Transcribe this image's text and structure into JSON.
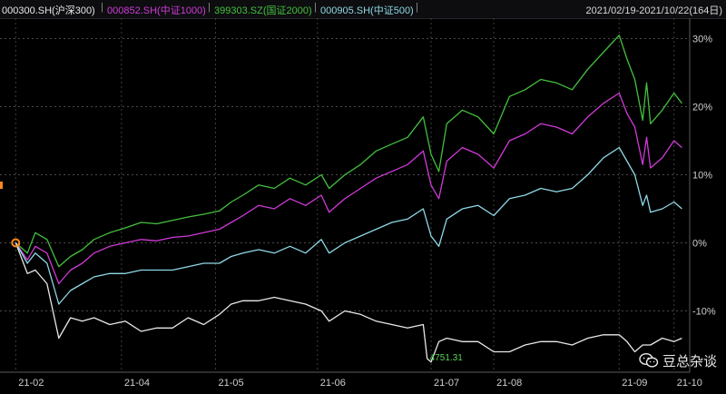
{
  "legend": {
    "items": [
      {
        "label": "000300.SH(沪深300)",
        "color": "#e8e8e8"
      },
      {
        "label": "000852.SH(中证1000)",
        "color": "#d03ad8"
      },
      {
        "label": "399303.SZ(国证2000)",
        "color": "#44c03e"
      },
      {
        "label": "000905.SH(中证500)",
        "color": "#8fd8e6"
      }
    ],
    "separator": "|",
    "range": "2021/02/19-2021/10/22(164日)"
  },
  "watermark": {
    "text": "豆总杂谈",
    "icon": "wechat-icon"
  },
  "chart_data": {
    "type": "line",
    "x_ticks": [
      "21-02",
      "21-04",
      "21-05",
      "21-06",
      "21-07",
      "21-08",
      "21-09",
      "21-10"
    ],
    "x_tick_days": [
      0,
      27,
      51,
      77,
      106,
      122,
      154,
      168
    ],
    "x_range_days": [
      -4,
      172
    ],
    "y_ticks": [
      "30%",
      "20%",
      "10%",
      "0%",
      "-10%"
    ],
    "y_tick_values": [
      30,
      20,
      10,
      0,
      -10
    ],
    "ylim": [
      -19,
      33
    ],
    "grid": true,
    "annotations": [
      {
        "series": "000300.SH(沪深300)",
        "x": 105,
        "text": "4751.31"
      }
    ],
    "series": [
      {
        "name": "399303.SZ(国证2000)",
        "color": "#44c03e",
        "x": [
          0,
          3,
          5,
          8,
          11,
          14,
          17,
          20,
          24,
          28,
          32,
          36,
          40,
          44,
          48,
          52,
          55,
          58,
          62,
          66,
          70,
          74,
          78,
          80,
          84,
          88,
          92,
          96,
          100,
          104,
          106,
          108,
          110,
          114,
          118,
          122,
          126,
          130,
          134,
          138,
          142,
          146,
          150,
          154,
          156,
          158,
          160,
          161,
          162,
          165,
          168,
          170
        ],
        "y": [
          0,
          -1.5,
          1.5,
          0.5,
          -3.5,
          -2,
          -1,
          0.5,
          1.5,
          2.2,
          3,
          2.8,
          3.3,
          3.8,
          4.2,
          4.7,
          6,
          7,
          8.5,
          8,
          9.5,
          8.5,
          10,
          8,
          10,
          11.5,
          13.5,
          14.5,
          15.5,
          18.5,
          13,
          10.5,
          17.5,
          19.5,
          18.5,
          16,
          21.5,
          22.5,
          24,
          23.5,
          22.5,
          25.5,
          28,
          30.5,
          27,
          24,
          18,
          23.5,
          17.5,
          19.5,
          22,
          20.5
        ]
      },
      {
        "name": "000852.SH(中证1000)",
        "color": "#d03ad8",
        "x": [
          0,
          3,
          5,
          8,
          11,
          14,
          17,
          20,
          24,
          28,
          32,
          36,
          40,
          44,
          48,
          52,
          55,
          58,
          62,
          66,
          70,
          74,
          78,
          80,
          84,
          88,
          92,
          96,
          100,
          104,
          106,
          108,
          110,
          114,
          118,
          122,
          126,
          130,
          134,
          138,
          142,
          146,
          150,
          154,
          156,
          158,
          160,
          161,
          162,
          165,
          168,
          170
        ],
        "y": [
          0,
          -2.5,
          -0.5,
          -1.5,
          -6,
          -4,
          -3,
          -1.5,
          -0.5,
          0,
          0.5,
          0.3,
          0.8,
          1,
          1.5,
          2,
          3,
          4,
          5.5,
          5,
          6.5,
          5.5,
          7,
          4.5,
          6.5,
          8,
          9.5,
          10.5,
          11.5,
          13.5,
          8.5,
          6.5,
          12,
          14,
          13,
          11,
          15,
          16,
          17.5,
          17,
          16,
          18.5,
          20.5,
          22,
          19,
          17,
          11.5,
          15.5,
          11,
          12.5,
          15,
          14
        ]
      },
      {
        "name": "000905.SH(中证500)",
        "color": "#8fd8e6",
        "x": [
          0,
          3,
          5,
          8,
          11,
          14,
          17,
          20,
          24,
          28,
          32,
          36,
          40,
          44,
          48,
          52,
          55,
          58,
          62,
          66,
          70,
          74,
          78,
          80,
          84,
          88,
          92,
          96,
          100,
          104,
          106,
          108,
          110,
          114,
          118,
          122,
          126,
          130,
          134,
          138,
          142,
          146,
          150,
          154,
          156,
          158,
          160,
          161,
          162,
          165,
          168,
          170
        ],
        "y": [
          0,
          -3,
          -1.5,
          -3,
          -9,
          -7,
          -6,
          -5,
          -4.5,
          -4.5,
          -4,
          -4,
          -4,
          -3.5,
          -3,
          -3,
          -2,
          -1.5,
          -1,
          -1.5,
          -0.5,
          -1.5,
          0.5,
          -1.5,
          0,
          1,
          2,
          3,
          3.5,
          5,
          1,
          -0.5,
          3.5,
          5,
          5.5,
          4,
          6.5,
          7,
          8,
          7.5,
          8,
          10,
          12.5,
          14,
          12,
          10,
          5.5,
          7,
          4.5,
          5,
          6,
          5
        ]
      },
      {
        "name": "000300.SH(沪深300)",
        "color": "#e8e8e8",
        "x": [
          0,
          3,
          5,
          8,
          11,
          14,
          17,
          20,
          24,
          28,
          32,
          36,
          40,
          44,
          48,
          52,
          55,
          58,
          62,
          66,
          70,
          74,
          78,
          80,
          84,
          88,
          92,
          96,
          100,
          104,
          105,
          106,
          108,
          110,
          114,
          118,
          122,
          126,
          130,
          134,
          138,
          142,
          146,
          150,
          154,
          156,
          158,
          160,
          162,
          165,
          168,
          170
        ],
        "y": [
          0,
          -4.5,
          -4,
          -6,
          -14,
          -11,
          -11.5,
          -11,
          -12,
          -11.5,
          -13,
          -12.5,
          -12.5,
          -11,
          -12,
          -10.5,
          -9,
          -8.5,
          -8.5,
          -8,
          -8.5,
          -9,
          -10,
          -11.5,
          -10,
          -10.5,
          -11.5,
          -12,
          -12.5,
          -12,
          -17,
          -17.5,
          -14.5,
          -14,
          -14.5,
          -14.5,
          -16,
          -16,
          -15,
          -14.5,
          -14.5,
          -15,
          -14,
          -13.5,
          -13.5,
          -14.5,
          -16,
          -15,
          -15,
          -14,
          -14.5,
          -14
        ]
      }
    ]
  }
}
